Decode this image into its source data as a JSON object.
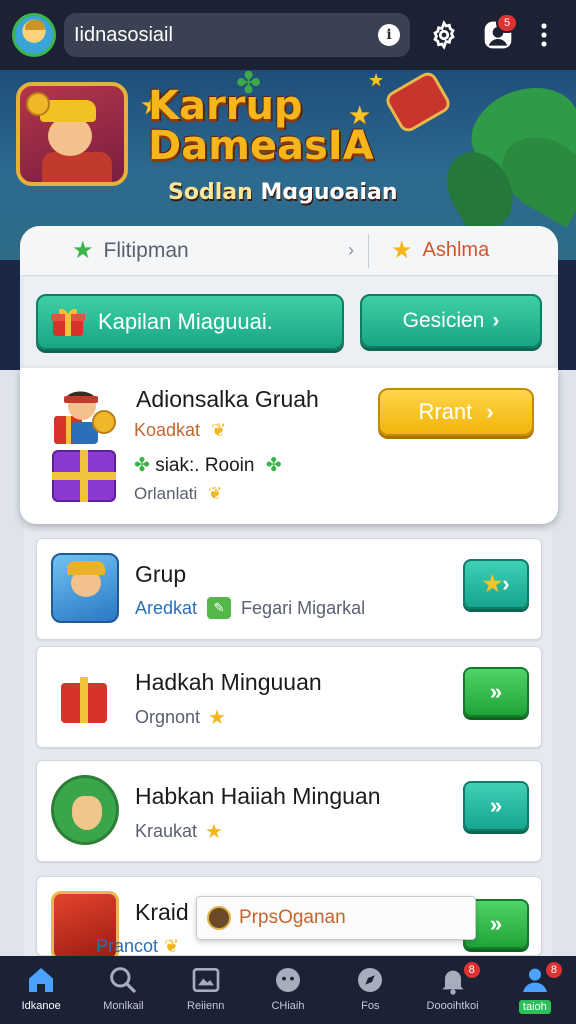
{
  "header": {
    "search_text": "Iidnasosiail",
    "notification_badge": "5",
    "icons": [
      "avatar",
      "info-icon",
      "gear-icon",
      "profile-icon",
      "more-vertical-icon"
    ]
  },
  "banner": {
    "title_line1": "Karrup",
    "title_line2": "DameasIA",
    "subtitle_accent": "Sodlan",
    "subtitle_rest": "Mɑɡuoaian"
  },
  "tabs": {
    "left_label": "Flitipman",
    "right_label": "Ashlma"
  },
  "actions": {
    "primary_label": "Kapilan Miaguuai.",
    "secondary_label": "Gesicien"
  },
  "featured": {
    "title": "Adionsalka Gruah",
    "meta1": "Koadkat",
    "meta2": "siak:. Rooin",
    "meta3": "Orlanlati",
    "button_label": "Rrant"
  },
  "list": [
    {
      "title": "Grup",
      "meta_accent": "Aredkat",
      "meta_rest": "Fegari Migarkal",
      "button": "teal"
    },
    {
      "title": "Hadkah Minguuan",
      "meta_text": "Orgnont",
      "button": "green"
    },
    {
      "title": "Habkan Haiiah Minguan",
      "meta_text": "Kraukat",
      "button": "teal"
    },
    {
      "title": "Kraid",
      "button": "green"
    }
  ],
  "toast": {
    "label": "PrpsOganan"
  },
  "peek_text": "Prancot",
  "bottom_nav": [
    {
      "label": "Idkanoe",
      "icon": "home-icon"
    },
    {
      "label": "Monlkail",
      "icon": "search-icon"
    },
    {
      "label": "Reiienn",
      "icon": "image-icon"
    },
    {
      "label": "CHiaih",
      "icon": "chat-icon"
    },
    {
      "label": "Fos",
      "icon": "compass-icon"
    },
    {
      "label": "Doooihtkoi",
      "icon": "bell-icon",
      "badge": "8"
    },
    {
      "label": "taioh",
      "icon": "user-icon",
      "badge": "8"
    }
  ],
  "colors": {
    "accent_teal": "#18a585",
    "accent_green": "#21a43b",
    "accent_yellow": "#f1b50a",
    "badge_red": "#e03131"
  }
}
